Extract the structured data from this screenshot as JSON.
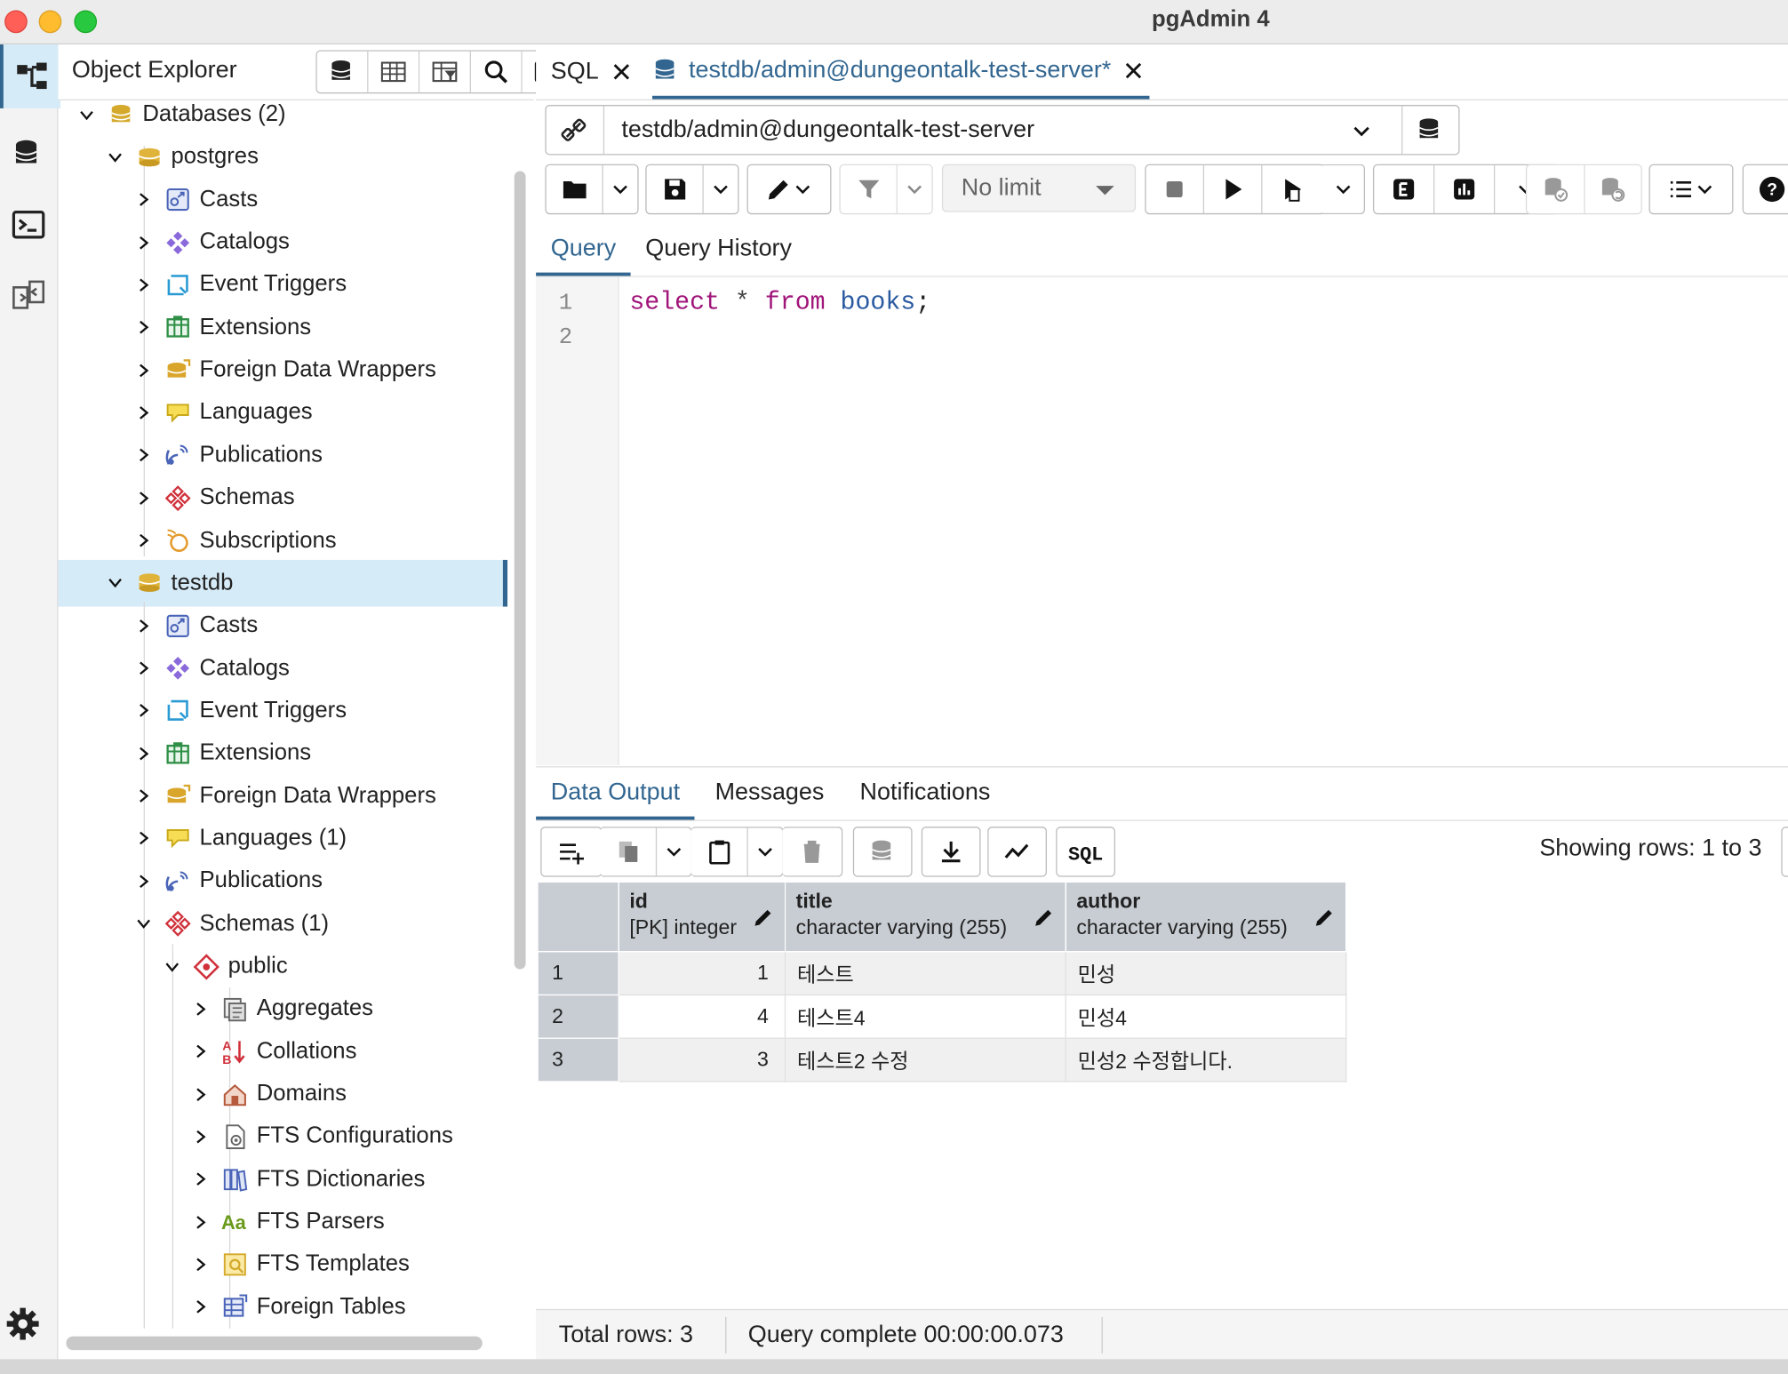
{
  "app": {
    "title": "pgAdmin 4"
  },
  "object_explorer": {
    "title": "Object Explorer",
    "tree": [
      {
        "id": "databases",
        "label": "Databases (2)",
        "icon": "databases-icon",
        "level": 1,
        "expanded": true
      },
      {
        "id": "postgres",
        "label": "postgres",
        "icon": "database-icon",
        "level": 2,
        "expanded": true
      },
      {
        "id": "pg-casts",
        "label": "Casts",
        "icon": "casts-icon",
        "level": 3
      },
      {
        "id": "pg-catalogs",
        "label": "Catalogs",
        "icon": "catalogs-icon",
        "level": 3
      },
      {
        "id": "pg-event-triggers",
        "label": "Event Triggers",
        "icon": "event-triggers-icon",
        "level": 3
      },
      {
        "id": "pg-extensions",
        "label": "Extensions",
        "icon": "extensions-icon",
        "level": 3
      },
      {
        "id": "pg-fdw",
        "label": "Foreign Data Wrappers",
        "icon": "foreign-data-wrappers-icon",
        "level": 3
      },
      {
        "id": "pg-languages",
        "label": "Languages",
        "icon": "languages-icon",
        "level": 3
      },
      {
        "id": "pg-publications",
        "label": "Publications",
        "icon": "publications-icon",
        "level": 3
      },
      {
        "id": "pg-schemas",
        "label": "Schemas",
        "icon": "schemas-icon",
        "level": 3
      },
      {
        "id": "pg-subscriptions",
        "label": "Subscriptions",
        "icon": "subscriptions-icon",
        "level": 3
      },
      {
        "id": "testdb",
        "label": "testdb",
        "icon": "database-icon",
        "level": 2,
        "expanded": true,
        "selected": true
      },
      {
        "id": "t-casts",
        "label": "Casts",
        "icon": "casts-icon",
        "level": 3
      },
      {
        "id": "t-catalogs",
        "label": "Catalogs",
        "icon": "catalogs-icon",
        "level": 3
      },
      {
        "id": "t-event-triggers",
        "label": "Event Triggers",
        "icon": "event-triggers-icon",
        "level": 3
      },
      {
        "id": "t-extensions",
        "label": "Extensions",
        "icon": "extensions-icon",
        "level": 3
      },
      {
        "id": "t-fdw",
        "label": "Foreign Data Wrappers",
        "icon": "foreign-data-wrappers-icon",
        "level": 3
      },
      {
        "id": "t-languages",
        "label": "Languages (1)",
        "icon": "languages-icon",
        "level": 3
      },
      {
        "id": "t-publications",
        "label": "Publications",
        "icon": "publications-icon",
        "level": 3
      },
      {
        "id": "t-schemas",
        "label": "Schemas (1)",
        "icon": "schemas-icon",
        "level": 3,
        "expanded": true
      },
      {
        "id": "public",
        "label": "public",
        "icon": "schema-icon",
        "level": 4,
        "expanded": true
      },
      {
        "id": "aggregates",
        "label": "Aggregates",
        "icon": "aggregates-icon",
        "level": 5
      },
      {
        "id": "collations",
        "label": "Collations",
        "icon": "collations-icon",
        "level": 5
      },
      {
        "id": "domains",
        "label": "Domains",
        "icon": "domains-icon",
        "level": 5
      },
      {
        "id": "fts-configurations",
        "label": "FTS Configurations",
        "icon": "fts-configurations-icon",
        "level": 5
      },
      {
        "id": "fts-dictionaries",
        "label": "FTS Dictionaries",
        "icon": "fts-dictionaries-icon",
        "level": 5
      },
      {
        "id": "fts-parsers",
        "label": "FTS Parsers",
        "icon": "fts-parsers-icon",
        "level": 5
      },
      {
        "id": "fts-templates",
        "label": "FTS Templates",
        "icon": "fts-templates-icon",
        "level": 5
      },
      {
        "id": "foreign-tables",
        "label": "Foreign Tables",
        "icon": "foreign-tables-icon",
        "level": 5
      }
    ]
  },
  "tabs": [
    {
      "label": "SQL",
      "active": false
    },
    {
      "label": "testdb/admin@dungeontalk-test-server*",
      "active": true,
      "icon": "database-icon"
    }
  ],
  "connection": {
    "value": "testdb/admin@dungeontalk-test-server"
  },
  "toolbar": {
    "limit": "No limit"
  },
  "query_tabs": [
    "Query",
    "Query History"
  ],
  "editor": {
    "line_numbers": [
      "1",
      "2"
    ],
    "code": {
      "kw1": "select",
      "op": "*",
      "kw2": "from",
      "ident": "books",
      "punc": ";"
    }
  },
  "output_tabs": [
    "Data Output",
    "Messages",
    "Notifications"
  ],
  "rows_info": "Showing rows: 1 to 3",
  "table": {
    "columns": [
      {
        "name": "id",
        "type": "[PK] integer"
      },
      {
        "name": "title",
        "type": "character varying (255)"
      },
      {
        "name": "author",
        "type": "character varying (255)"
      }
    ],
    "rows": [
      {
        "n": "1",
        "id": "1",
        "title": "테스트",
        "author": "민성"
      },
      {
        "n": "2",
        "id": "4",
        "title": "테스트4",
        "author": "민성4"
      },
      {
        "n": "3",
        "id": "3",
        "title": "테스트2 수정",
        "author": "민성2 수정합니다."
      }
    ]
  },
  "status": {
    "total_rows": "Total rows: 3",
    "query_complete": "Query complete 00:00:00.073"
  },
  "colors": {
    "accent": "#326690",
    "selection": "#d6ebf8",
    "header_bg": "#c8cdd3",
    "keyword": "#a0157a",
    "identifier": "#2a5aa0"
  }
}
